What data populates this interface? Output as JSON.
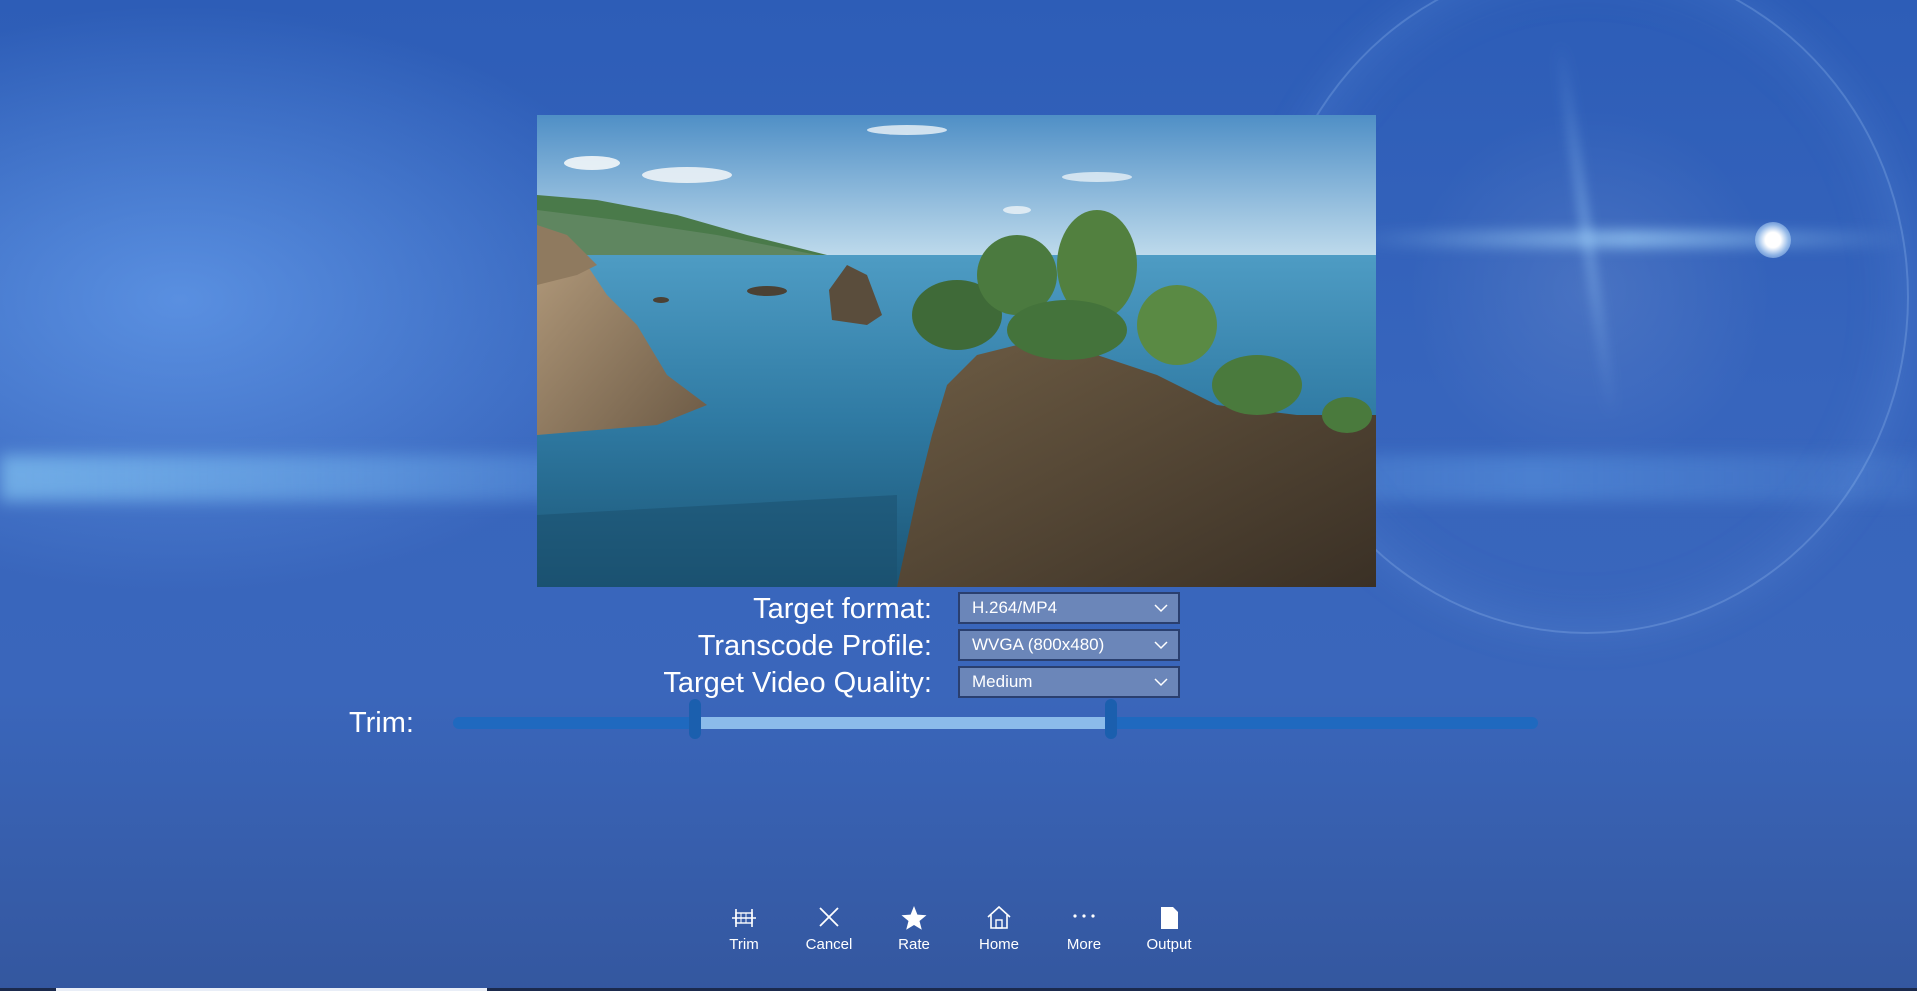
{
  "settings": {
    "target_format_label": "Target format:",
    "target_format_value": "H.264/MP4",
    "transcode_profile_label": "Transcode Profile:",
    "transcode_profile_value": "WVGA (800x480)",
    "video_quality_label": "Target Video Quality:",
    "video_quality_value": "Medium"
  },
  "trim": {
    "label": "Trim:",
    "start_fraction": 0.223,
    "end_fraction": 0.606
  },
  "commands": [
    {
      "label": "Trim",
      "icon": "trim-icon"
    },
    {
      "label": "Cancel",
      "icon": "close-icon"
    },
    {
      "label": "Rate",
      "icon": "star-icon"
    },
    {
      "label": "Home",
      "icon": "home-icon"
    },
    {
      "label": "More",
      "icon": "more-icon"
    },
    {
      "label": "Output",
      "icon": "document-icon"
    }
  ],
  "colors": {
    "background": "#3765bd",
    "slider_track": "#1f69bf",
    "slider_range": "#8bbbea",
    "select_fill": "#6b86b9"
  }
}
